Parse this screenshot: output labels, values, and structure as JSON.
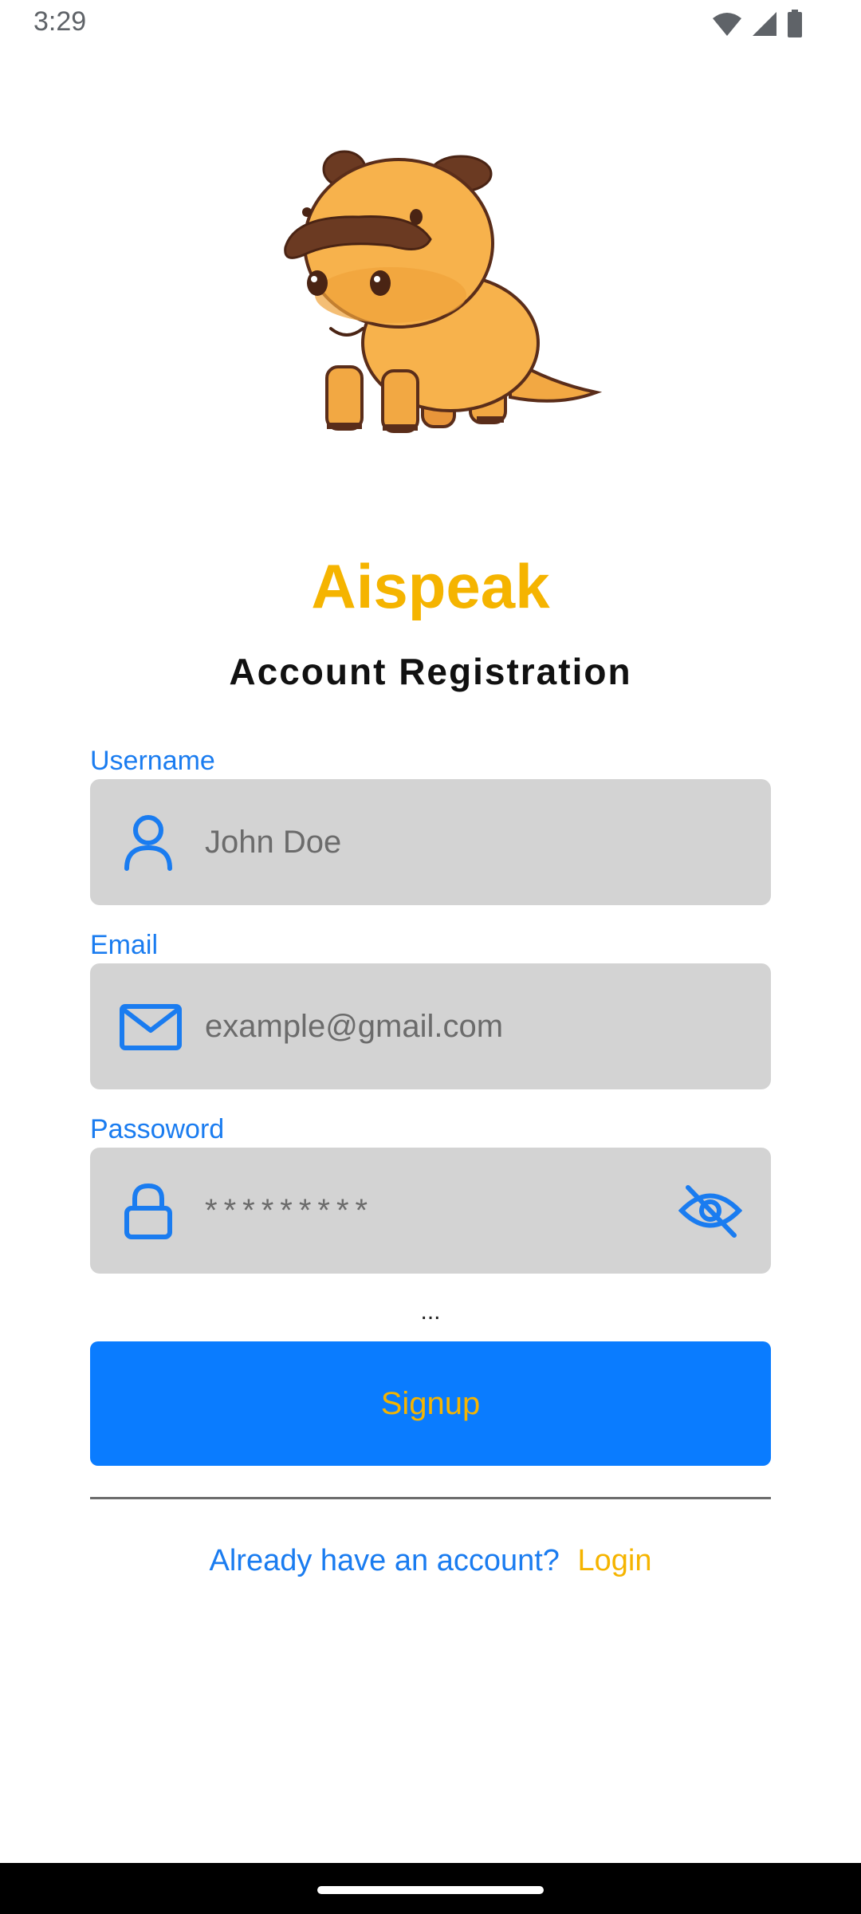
{
  "status_bar": {
    "time": "3:29",
    "icons": [
      "wifi-icon",
      "cellular-signal-icon",
      "battery-icon"
    ]
  },
  "mascot": {
    "icon": "hippo-mascot"
  },
  "app": {
    "title": "Aispeak",
    "subtitle": "Account Registration"
  },
  "form": {
    "username": {
      "label": "Username",
      "placeholder": "John Doe",
      "value": "",
      "icon": "person-icon"
    },
    "email": {
      "label": "Email",
      "placeholder": "example@gmail.com",
      "value": "",
      "icon": "mail-icon"
    },
    "password": {
      "label": "Passoword",
      "placeholder": "*********",
      "value": "",
      "icon": "lock-icon",
      "toggle_icon": "eye-off-icon"
    },
    "ellipsis": "...",
    "submit_label": "Signup"
  },
  "footer": {
    "prompt": "Already have an account?",
    "login_label": "Login"
  },
  "colors": {
    "accent": "#0a7cff",
    "brand": "#f5b400",
    "label": "#1a7cf0",
    "field_bg": "#d3d3d3"
  }
}
